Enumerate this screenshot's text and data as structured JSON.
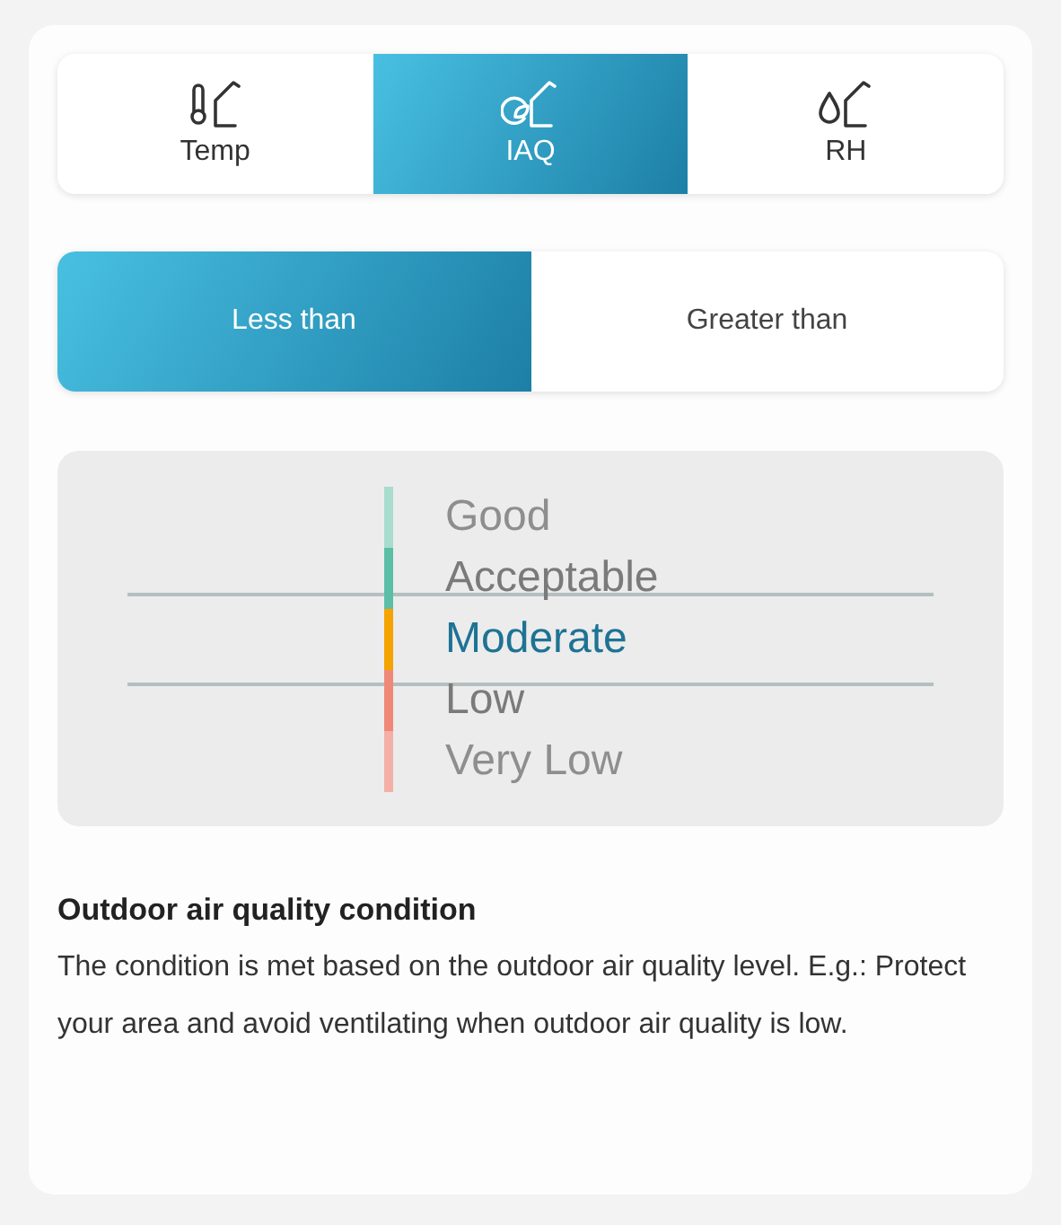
{
  "tabs": [
    {
      "label": "Temp",
      "kind": "temp",
      "selected": false
    },
    {
      "label": "IAQ",
      "kind": "iaq",
      "selected": true
    },
    {
      "label": "RH",
      "kind": "rh",
      "selected": false
    }
  ],
  "comparison": [
    {
      "label": "Less than",
      "selected": true
    },
    {
      "label": "Greater than",
      "selected": false
    }
  ],
  "levels": [
    {
      "label": "Good",
      "color": "#a8dccd",
      "selected": false
    },
    {
      "label": "Acceptable",
      "color": "#5bbfa8",
      "selected": false
    },
    {
      "label": "Moderate",
      "color": "#f5a300",
      "selected": true
    },
    {
      "label": "Low",
      "color": "#f08878",
      "selected": false
    },
    {
      "label": "Very Low",
      "color": "#f4b0a6",
      "selected": false
    }
  ],
  "description": {
    "title": "Outdoor air quality condition",
    "text": "The condition is met based on the outdoor air quality level. E.g.: Protect your area and avoid ventilating when outdoor air quality is low."
  }
}
